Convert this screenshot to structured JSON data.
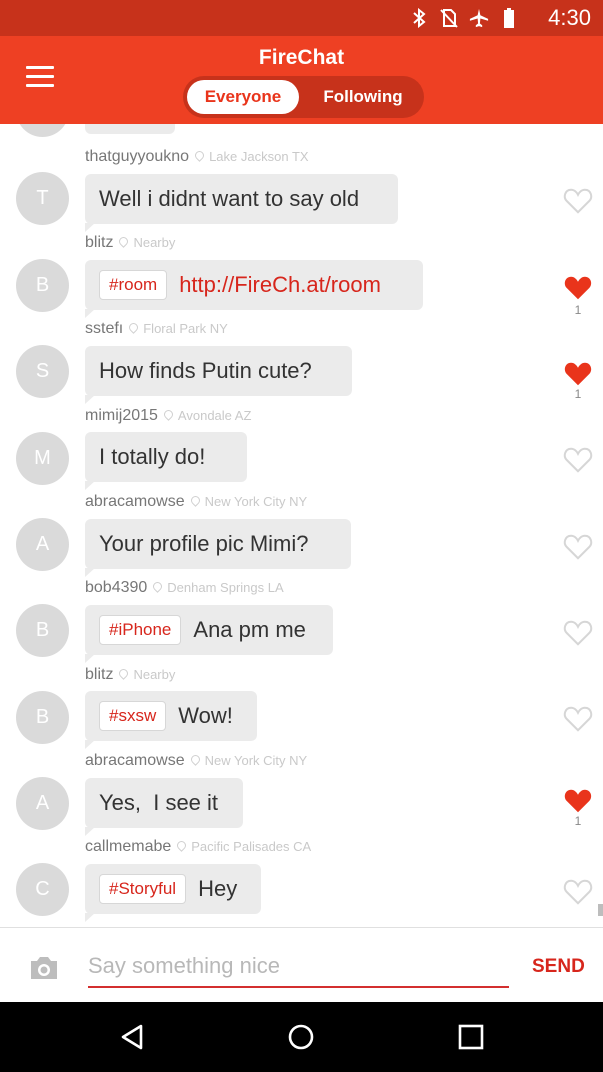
{
  "status_bar": {
    "time": "4:30",
    "icons": [
      "bluetooth-icon",
      "no-sim-icon",
      "airplane-mode-icon",
      "battery-icon"
    ]
  },
  "app_bar": {
    "title": "FireChat",
    "tabs": [
      {
        "label": "Everyone",
        "active": true
      },
      {
        "label": "Following",
        "active": false
      }
    ]
  },
  "messages": [
    {
      "username": "thatguyyoukno",
      "location": "Lake Jackson TX",
      "avatar": "T",
      "tag": "",
      "text": "Well i didnt want to say old",
      "link": "",
      "liked": false,
      "likes": ""
    },
    {
      "username": "blitz",
      "location": "Nearby",
      "avatar": "B",
      "tag": "#room",
      "text": "",
      "link": "http://FireCh.at/room",
      "liked": true,
      "likes": "1"
    },
    {
      "username": "sstefı",
      "location": "Floral Park NY",
      "avatar": "S",
      "tag": "",
      "text": "How finds Putin cute?",
      "link": "",
      "liked": true,
      "likes": "1"
    },
    {
      "username": "mimij2015",
      "location": "Avondale AZ",
      "avatar": "M",
      "tag": "",
      "text": "I totally do!",
      "link": "",
      "liked": false,
      "likes": ""
    },
    {
      "username": "abracamowse",
      "location": "New York City NY",
      "avatar": "A",
      "tag": "",
      "text": "Your profile pic Mimi?",
      "link": "",
      "liked": false,
      "likes": ""
    },
    {
      "username": "bob4390",
      "location": "Denham Springs LA",
      "avatar": "B",
      "tag": "#iPhone",
      "text": "Ana pm me",
      "link": "",
      "liked": false,
      "likes": ""
    },
    {
      "username": "blitz",
      "location": "Nearby",
      "avatar": "B",
      "tag": "#sxsw",
      "text": "Wow!",
      "link": "",
      "liked": false,
      "likes": ""
    },
    {
      "username": "abracamowse",
      "location": "New York City NY",
      "avatar": "A",
      "tag": "",
      "text": "Yes,  I see it",
      "link": "",
      "liked": true,
      "likes": "1"
    },
    {
      "username": "callmemabe",
      "location": "Pacific Palisades CA",
      "avatar": "C",
      "tag": "#Storyful",
      "text": "Hey",
      "link": "",
      "liked": false,
      "likes": ""
    }
  ],
  "composer": {
    "placeholder": "Say something nice",
    "value": "",
    "send_label": "SEND"
  },
  "nav_bar": {
    "buttons": [
      "back-icon",
      "home-icon",
      "recents-icon"
    ]
  },
  "colors": {
    "status_bar": "#c7321b",
    "app_bar": "#ee4023",
    "accent": "#d7261c",
    "bubble": "#ebebeb",
    "avatar": "#dadada",
    "heart_active": "#e9341b",
    "heart_inactive": "#d6d6d6"
  }
}
